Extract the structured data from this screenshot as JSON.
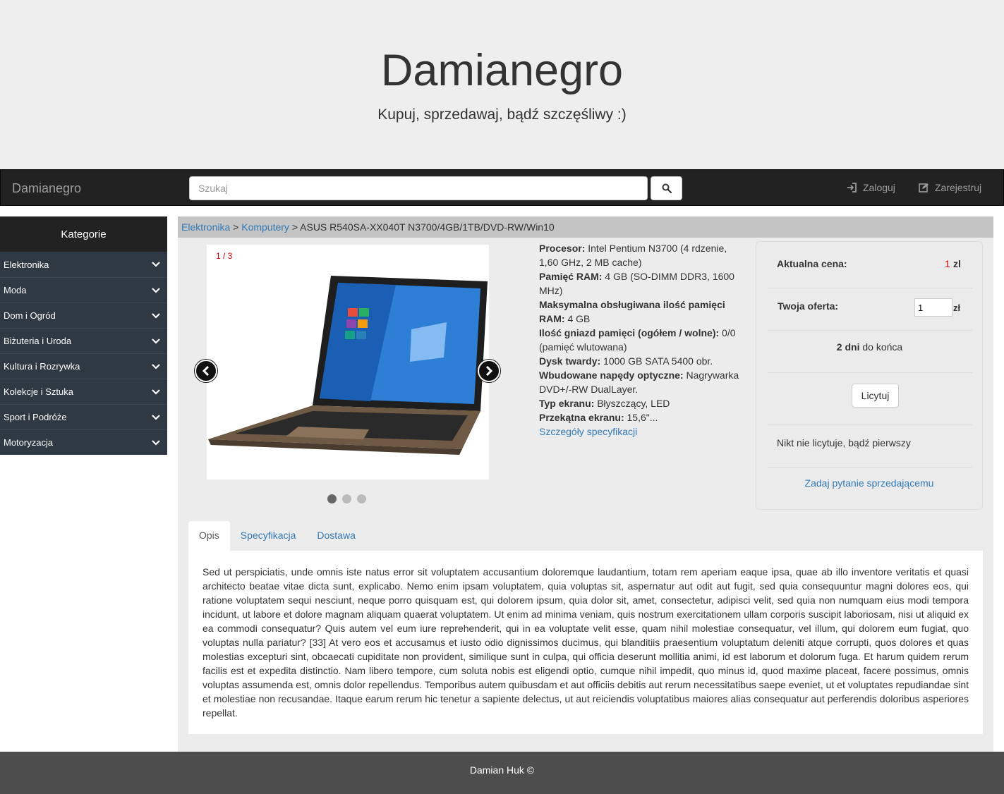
{
  "hero": {
    "title": "Damianegro",
    "subtitle": "Kupuj, sprzedawaj, bądź szczęśliwy :)"
  },
  "navbar": {
    "brand": "Damianegro",
    "search_placeholder": "Szukaj",
    "search_icon": "search-icon",
    "login": "Zaloguj",
    "login_icon": "log-in-icon",
    "register": "Zarejestruj",
    "register_icon": "edit-icon"
  },
  "sidebar": {
    "title": "Kategorie",
    "items": [
      {
        "label": "Elektronika"
      },
      {
        "label": "Moda"
      },
      {
        "label": "Dom i Ogród"
      },
      {
        "label": "Biżuteria i Uroda"
      },
      {
        "label": "Kultura i Rozrywka"
      },
      {
        "label": "Kolekcje i Sztuka"
      },
      {
        "label": "Sport i Podróże"
      },
      {
        "label": "Motoryzacja"
      }
    ]
  },
  "breadcrumb": {
    "level1": "Elektronika",
    "sep": ">",
    "level2": "Komputery",
    "current": "ASUS R540SA-XX040T N3700/4GB/1TB/DVD-RW/Win10"
  },
  "carousel": {
    "counter": "1 / 3",
    "slide_count": 3,
    "active_slide": 1
  },
  "specs": [
    {
      "label": "Procesor:",
      "value": "Intel Pentium N3700 (4 rdzenie, 1,60 GHz, 2 MB cache)"
    },
    {
      "label": "Pamięć RAM:",
      "value": "4 GB (SO-DIMM DDR3, 1600 MHz)"
    },
    {
      "label": "Maksymalna obsługiwana ilość pamięci RAM:",
      "value": "4 GB"
    },
    {
      "label": "Ilość gniazd pamięci (ogółem / wolne):",
      "value": "0/0 (pamięć wlutowana)"
    },
    {
      "label": "Dysk twardy:",
      "value": "1000 GB SATA 5400 obr."
    },
    {
      "label": "Wbudowane napędy optyczne:",
      "value": "Nagrywarka DVD+/-RW DualLayer."
    },
    {
      "label": "Typ ekranu:",
      "value": "Błyszczący, LED"
    },
    {
      "label": "Przekątna ekranu:",
      "value": "15,6\"..."
    }
  ],
  "specs_link": "Szczegóły specyfikacji",
  "bid": {
    "price_label": "Aktualna cena:",
    "price_value": "1",
    "price_currency": "zl",
    "offer_label": "Twoja oferta:",
    "offer_value": "1",
    "offer_currency": "zł",
    "days_bold": "2 dni",
    "days_rest": "do końca",
    "button": "Licytuj",
    "status": "Nikt nie licytuje, bądź pierwszy",
    "ask_link": "Zadaj pytanie sprzedającemu"
  },
  "tabs": [
    {
      "label": "Opis",
      "active": true
    },
    {
      "label": "Specyfikacja",
      "active": false
    },
    {
      "label": "Dostawa",
      "active": false
    }
  ],
  "description": "Sed ut perspiciatis, unde omnis iste natus error sit voluptatem accusantium doloremque laudantium, totam rem aperiam eaque ipsa, quae ab illo inventore veritatis et quasi architecto beatae vitae dicta sunt, explicabo. Nemo enim ipsam voluptatem, quia voluptas sit, aspernatur aut odit aut fugit, sed quia consequuntur magni dolores eos, qui ratione voluptatem sequi nesciunt, neque porro quisquam est, qui dolorem ipsum, quia dolor sit, amet, consectetur, adipisci velit, sed quia non numquam eius modi tempora incidunt, ut labore et dolore magnam aliquam quaerat voluptatem. Ut enim ad minima veniam, quis nostrum exercitationem ullam corporis suscipit laboriosam, nisi ut aliquid ex ea commodi consequatur? Quis autem vel eum iure reprehenderit, qui in ea voluptate velit esse, quam nihil molestiae consequatur, vel illum, qui dolorem eum fugiat, quo voluptas nulla pariatur? [33] At vero eos et accusamus et iusto odio dignissimos ducimus, qui blanditiis praesentium voluptatum deleniti atque corrupti, quos dolores et quas molestias excepturi sint, obcaecati cupiditate non provident, similique sunt in culpa, qui officia deserunt mollitia animi, id est laborum et dolorum fuga. Et harum quidem rerum facilis est et expedita distinctio. Nam libero tempore, cum soluta nobis est eligendi optio, cumque nihil impedit, quo minus id, quod maxime placeat, facere possimus, omnis voluptas assumenda est, omnis dolor repellendus. Temporibus autem quibusdam et aut officiis debitis aut rerum necessitatibus saepe eveniet, ut et voluptates repudiandae sint et molestiae non recusandae. Itaque earum rerum hic tenetur a sapiente delectus, ut aut reiciendis voluptatibus maiores alias consequatur aut perferendis doloribus asperiores repellat.",
  "footer": "Damian Huk ©"
}
